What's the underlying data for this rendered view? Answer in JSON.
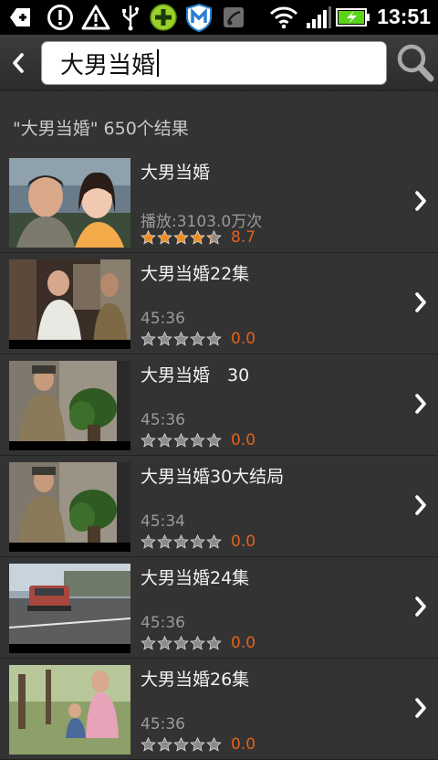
{
  "status_bar": {
    "time": "13:51",
    "icons": [
      "usb-debug-icon",
      "alert-circle-icon",
      "warning-triangle-icon",
      "usb-icon",
      "plus-app-icon",
      "shield-app-icon",
      "notification-app-icon",
      "wifi-icon",
      "signal-icon",
      "battery-charging-icon"
    ]
  },
  "search": {
    "query": "大男当婚",
    "back_icon": "chevron-left-icon",
    "search_icon": "magnifier-icon"
  },
  "results": {
    "summary": "\"大男当婚\" 650个结果",
    "items": [
      {
        "title": "大男当婚",
        "meta": "播放:3103.0万次",
        "rating": 4.35,
        "score": "8.7"
      },
      {
        "title": "大男当婚22集",
        "meta": "45:36",
        "rating": 0,
        "score": "0.0"
      },
      {
        "title": "大男当婚　30",
        "meta": "45:36",
        "rating": 0,
        "score": "0.0"
      },
      {
        "title": "大男当婚30大结局",
        "meta": "45:34",
        "rating": 0,
        "score": "0.0"
      },
      {
        "title": "大男当婚24集",
        "meta": "45:36",
        "rating": 0,
        "score": "0.0"
      },
      {
        "title": "大男当婚26集",
        "meta": "45:36",
        "rating": 0,
        "score": "0.0"
      }
    ]
  },
  "colors": {
    "accent": "#e3611c",
    "star_filled": "#f08a1c",
    "star_empty": "#8a8a8a"
  }
}
